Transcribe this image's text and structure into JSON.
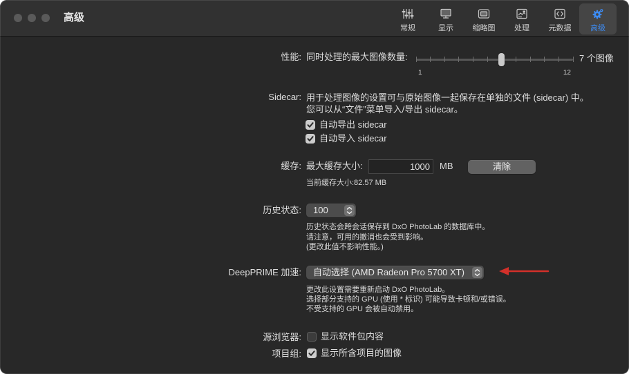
{
  "window": {
    "title": "高级"
  },
  "toolbar": {
    "accent_color": "#3d8bf2",
    "items": [
      {
        "label": "常规",
        "icon": "sliders-icon",
        "selected": false
      },
      {
        "label": "显示",
        "icon": "display-icon",
        "selected": false
      },
      {
        "label": "缩略图",
        "icon": "thumbnails-icon",
        "selected": false
      },
      {
        "label": "处理",
        "icon": "processing-icon",
        "selected": false
      },
      {
        "label": "元数据",
        "icon": "metadata-icon",
        "selected": false
      },
      {
        "label": "高级",
        "icon": "gear-icon",
        "selected": true
      }
    ]
  },
  "performance": {
    "label": "性能:",
    "caption": "同时处理的最大图像数量:",
    "slider": {
      "min": 1,
      "max": 12,
      "value": 7,
      "min_label": "1",
      "max_label": "12"
    },
    "value_text": "7 个图像"
  },
  "sidecar": {
    "label": "Sidecar:",
    "description_lines": [
      "用于处理图像的设置可与原始图像一起保存在单独的文件 (sidecar) 中。",
      "您可以从“文件”菜单导入/导出 sidecar。"
    ],
    "auto_export": {
      "label": "自动导出 sidecar",
      "checked": true
    },
    "auto_import": {
      "label": "自动导入 sidecar",
      "checked": true
    }
  },
  "cache": {
    "label": "缓存:",
    "max_size_label": "最大缓存大小:",
    "max_size_value": "1000",
    "unit": "MB",
    "clear_button": "清除",
    "current_size": "当前缓存大小:82.57 MB"
  },
  "history": {
    "label": "历史状态:",
    "value": "100",
    "notes": [
      "历史状态会跨会话保存到 DxO PhotoLab 的数据库中。",
      "请注意，可用的撤消也会受到影响。",
      "(更改此值不影响性能。)"
    ]
  },
  "deepprime": {
    "label": "DeepPRIME 加速:",
    "value": "自动选择 (AMD Radeon Pro 5700 XT)",
    "notes": [
      "更改此设置需要重新启动 DxO PhotoLab。",
      "选择部分支持的 GPU (使用 * 标识) 可能导致卡顿和/或错误。",
      "不受支持的 GPU 会被自动禁用。"
    ]
  },
  "source_browser": {
    "label": "源浏览器:",
    "option": {
      "label": "显示软件包内容",
      "checked": false
    }
  },
  "project_group": {
    "label": "项目组:",
    "option": {
      "label": "显示所含项目的图像",
      "checked": true
    }
  },
  "annotation": {
    "arrow_color": "#d3302a"
  }
}
